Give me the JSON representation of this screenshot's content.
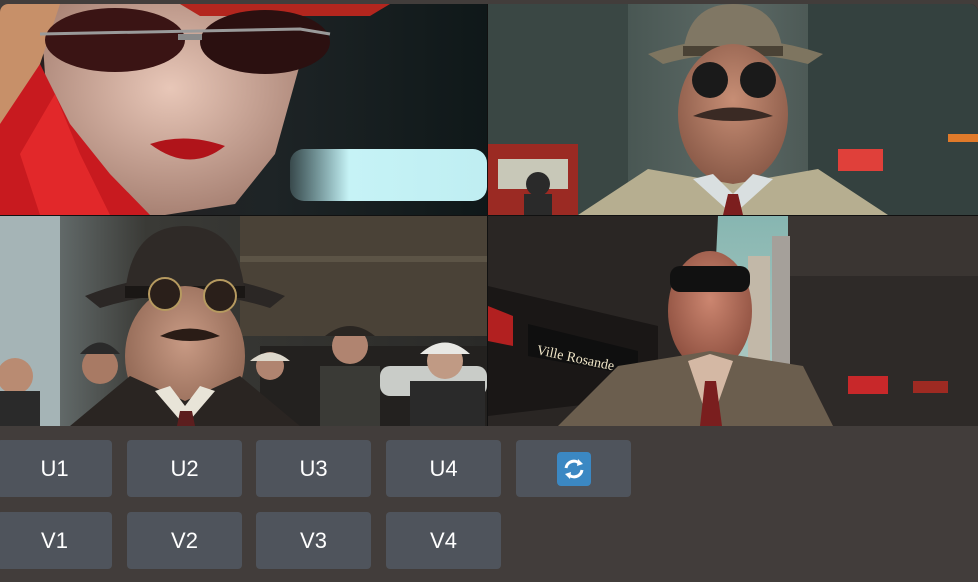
{
  "images": {
    "top_left": "generated-image-1",
    "top_right": "generated-image-2",
    "bottom_left": "generated-image-3",
    "bottom_right": "generated-image-4",
    "bottom_right_sign_text": "Ville Rosande"
  },
  "upscale_buttons": [
    "U1",
    "U2",
    "U3",
    "U4"
  ],
  "variation_buttons": [
    "V1",
    "V2",
    "V3",
    "V4"
  ],
  "reroll_button": {
    "icon": "refresh-icon"
  },
  "colors": {
    "background": "#423d3b",
    "button": "#4f545c",
    "button_text": "#ffffff",
    "reroll_icon_bg": "#3b88c3"
  }
}
